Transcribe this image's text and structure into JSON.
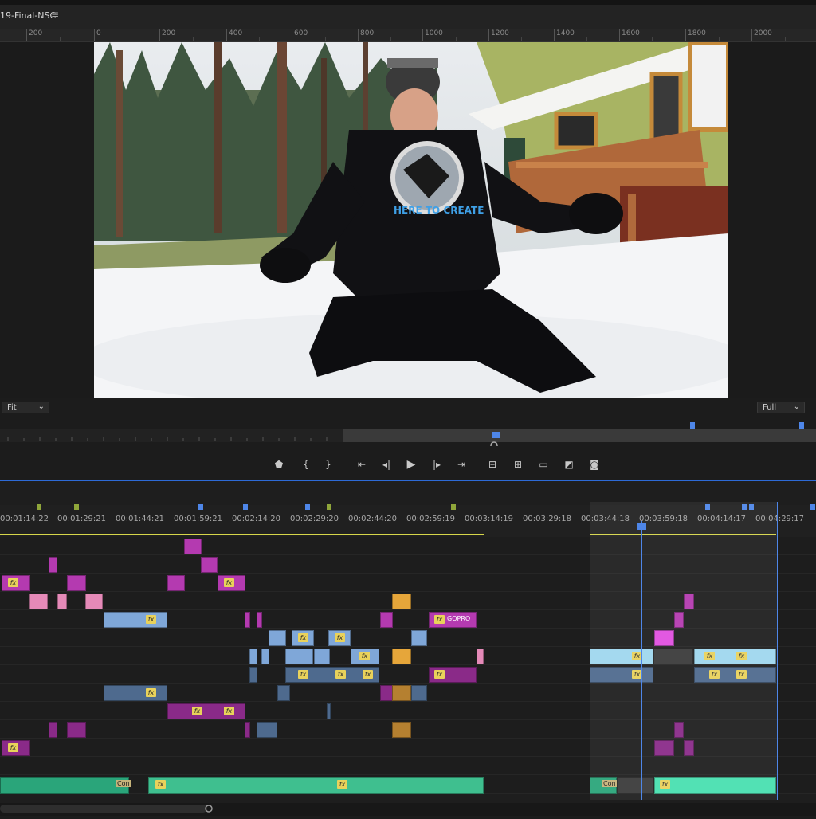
{
  "sequence": {
    "title": "19-Final-NSC",
    "menu_icon": "hamburger-icon"
  },
  "monitor_ruler": {
    "labels": [
      "200",
      "0",
      "200",
      "400",
      "600",
      "800",
      "1000",
      "1200",
      "1400",
      "1600",
      "1800",
      "2000"
    ]
  },
  "monitor": {
    "fit_select": {
      "value": "Fit"
    },
    "quality_select": {
      "value": "Full"
    },
    "image": {
      "shirt_text": "HERE TO CREATE"
    }
  },
  "transport": {
    "buttons": [
      "marker-icon",
      "mark-in-icon",
      "mark-out-icon",
      "go-to-in-icon",
      "step-back-icon",
      "play-icon",
      "step-forward-icon",
      "go-to-out-icon",
      "lift-icon",
      "extract-icon",
      "compare-icon",
      "overwrite-icon",
      "camera-icon"
    ]
  },
  "timeline": {
    "timecodes": [
      "00:01:14:22",
      "00:01:29:21",
      "00:01:44:21",
      "00:01:59:21",
      "00:02:14:20",
      "00:02:29:20",
      "00:02:44:20",
      "00:02:59:19",
      "00:03:14:19",
      "00:03:29:18",
      "00:03:44:18",
      "00:03:59:18",
      "00:04:14:17",
      "00:04:29:17"
    ],
    "clip_labels": {
      "gopro": "GOPRO",
      "con1": "Con",
      "con2": "Con"
    },
    "colors": {
      "magenta": "#b43ab0",
      "pink": "#e58ab8",
      "blue": "#7fa7d8",
      "orange": "#e6a63a",
      "green": "#3fbf8f",
      "cyan": "#9fd7ef",
      "playhead": "#4e86e8"
    }
  }
}
